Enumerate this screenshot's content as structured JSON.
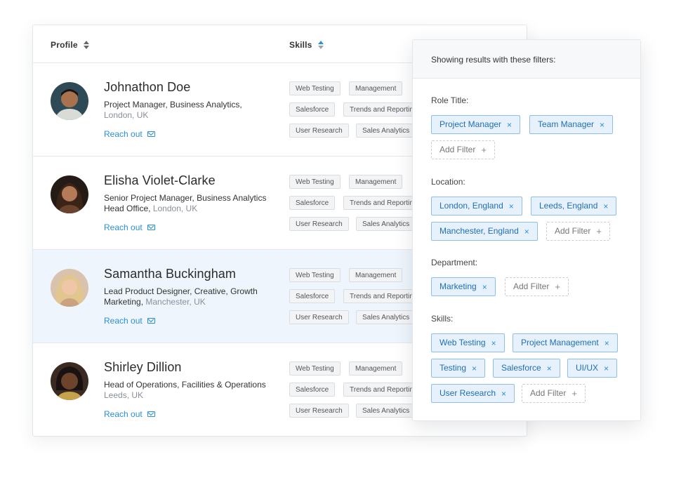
{
  "table": {
    "col_profile": "Profile",
    "col_skills": "Skills",
    "reach_label": "Reach out",
    "rows": [
      {
        "name": "Johnathon Doe",
        "role": "Project Manager, Business Analytics,",
        "location": "London, UK",
        "skills": [
          "Web Testing",
          "Management",
          "Salesforce",
          "Trends and Reporting",
          "User Research",
          "Sales Analytics"
        ]
      },
      {
        "name": "Elisha Violet-Clarke",
        "role": "Senior Project Manager, Business Analytics",
        "role_line2": "Head Office,",
        "location": "London, UK",
        "skills": [
          "Web Testing",
          "Management",
          "Salesforce",
          "Trends and Reporting",
          "User Research",
          "Sales Analytics"
        ]
      },
      {
        "name": "Samantha Buckingham",
        "role": "Lead Product Designer, Creative, Growth",
        "role_line2": "Marketing,",
        "location": "Manchester, UK",
        "skills": [
          "Web Testing",
          "Management",
          "Salesforce",
          "Trends and Reporting",
          "User Research",
          "Sales Analytics"
        ]
      },
      {
        "name": "Shirley Dillion",
        "role": "Head of Operations, Facilities & Operations",
        "location": "Leeds, UK",
        "skills": [
          "Web Testing",
          "Management",
          "Salesforce",
          "Trends and Reporting",
          "User Research",
          "Sales Analytics"
        ]
      }
    ]
  },
  "filters": {
    "header": "Showing results with these filters:",
    "add_label": "Add Filter",
    "role_title": {
      "label": "Role Title:",
      "chips": [
        "Project Manager",
        "Team Manager"
      ]
    },
    "location": {
      "label": "Location:",
      "chips": [
        "London, England",
        "Leeds, England",
        "Manchester, England"
      ]
    },
    "department": {
      "label": "Department:",
      "chips": [
        "Marketing"
      ]
    },
    "skills": {
      "label": "Skills:",
      "chips": [
        "Web Testing",
        "Project Management",
        "Testing",
        "Salesforce",
        "UI/UX",
        "User Research"
      ]
    }
  },
  "icons": {
    "sort": "sort-icon",
    "mail": "mail-icon",
    "remove": "close-icon",
    "add": "plus-icon"
  },
  "colors": {
    "accent": "#2a8fd8",
    "chip_bg": "#e6f1fb",
    "highlight_row": "#eef5fc"
  }
}
